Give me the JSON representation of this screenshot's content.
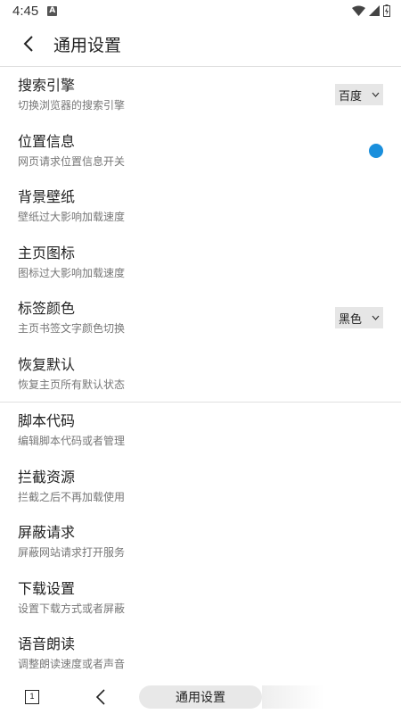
{
  "status": {
    "time": "4:45",
    "notif_icon": "A"
  },
  "header": {
    "title": "通用设置"
  },
  "items": [
    {
      "title": "搜索引擎",
      "subtitle": "切换浏览器的搜索引擎",
      "control": "select",
      "value": "百度"
    },
    {
      "title": "位置信息",
      "subtitle": "网页请求位置信息开关",
      "control": "toggle",
      "toggle_color": "#1a8fdc"
    },
    {
      "title": "背景壁纸",
      "subtitle": "壁纸过大影响加载速度"
    },
    {
      "title": "主页图标",
      "subtitle": "图标过大影响加载速度"
    },
    {
      "title": "标签颜色",
      "subtitle": "主页书签文字颜色切换",
      "control": "select",
      "value": "黑色"
    },
    {
      "title": "恢复默认",
      "subtitle": "恢复主页所有默认状态"
    },
    {
      "title": "脚本代码",
      "subtitle": "编辑脚本代码或者管理"
    },
    {
      "title": "拦截资源",
      "subtitle": "拦截之后不再加载使用"
    },
    {
      "title": "屏蔽请求",
      "subtitle": "屏蔽网站请求打开服务"
    },
    {
      "title": "下载设置",
      "subtitle": "设置下载方式或者屏蔽"
    },
    {
      "title": "语音朗读",
      "subtitle": "调整朗读速度或者声音"
    }
  ],
  "bottom": {
    "tab_count": "1",
    "address": "通用设置"
  }
}
